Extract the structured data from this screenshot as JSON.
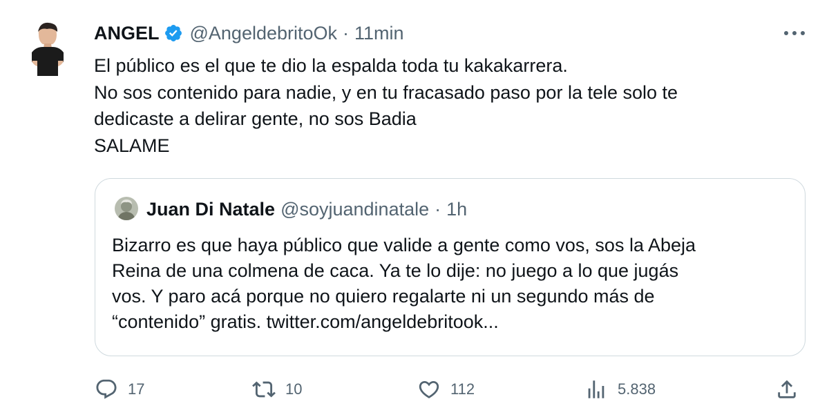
{
  "tweet": {
    "author": {
      "name": "ANGEL",
      "handle": "@AngeldebritoOk",
      "separator": "·",
      "time": "11min",
      "verified_color": "#1d9bf0"
    },
    "text_lines": [
      "El público es el que te dio la espalda toda tu kakakarrera.",
      "No sos contenido para nadie, y en tu fracasado paso por la tele solo te",
      "dedicaste a delirar gente, no sos Badia",
      "SALAME"
    ],
    "quote": {
      "author": {
        "name": "Juan Di Natale",
        "handle": "@soyjuandinatale",
        "separator": "·",
        "time": "1h"
      },
      "text_lines": [
        "Bizarro es que haya público que valide a gente como vos, sos la Abeja",
        "Reina de una colmena de caca. Ya te lo dije: no juego a lo que jugás",
        "vos. Y paro acá porque no quiero regalarte ni un segundo más de",
        "“contenido” gratis. twitter.com/angeldebritook..."
      ]
    },
    "actions": {
      "replies": "17",
      "retweets": "10",
      "likes": "112",
      "views": "5.838"
    },
    "icons": {
      "more": "more-horizontal-icon",
      "reply": "reply-icon",
      "retweet": "retweet-icon",
      "like": "heart-icon",
      "views": "views-icon",
      "share": "share-icon"
    },
    "colors": {
      "text": "#0f1419",
      "secondary": "#536471",
      "border": "#cfd9de",
      "verified": "#1d9bf0"
    }
  }
}
